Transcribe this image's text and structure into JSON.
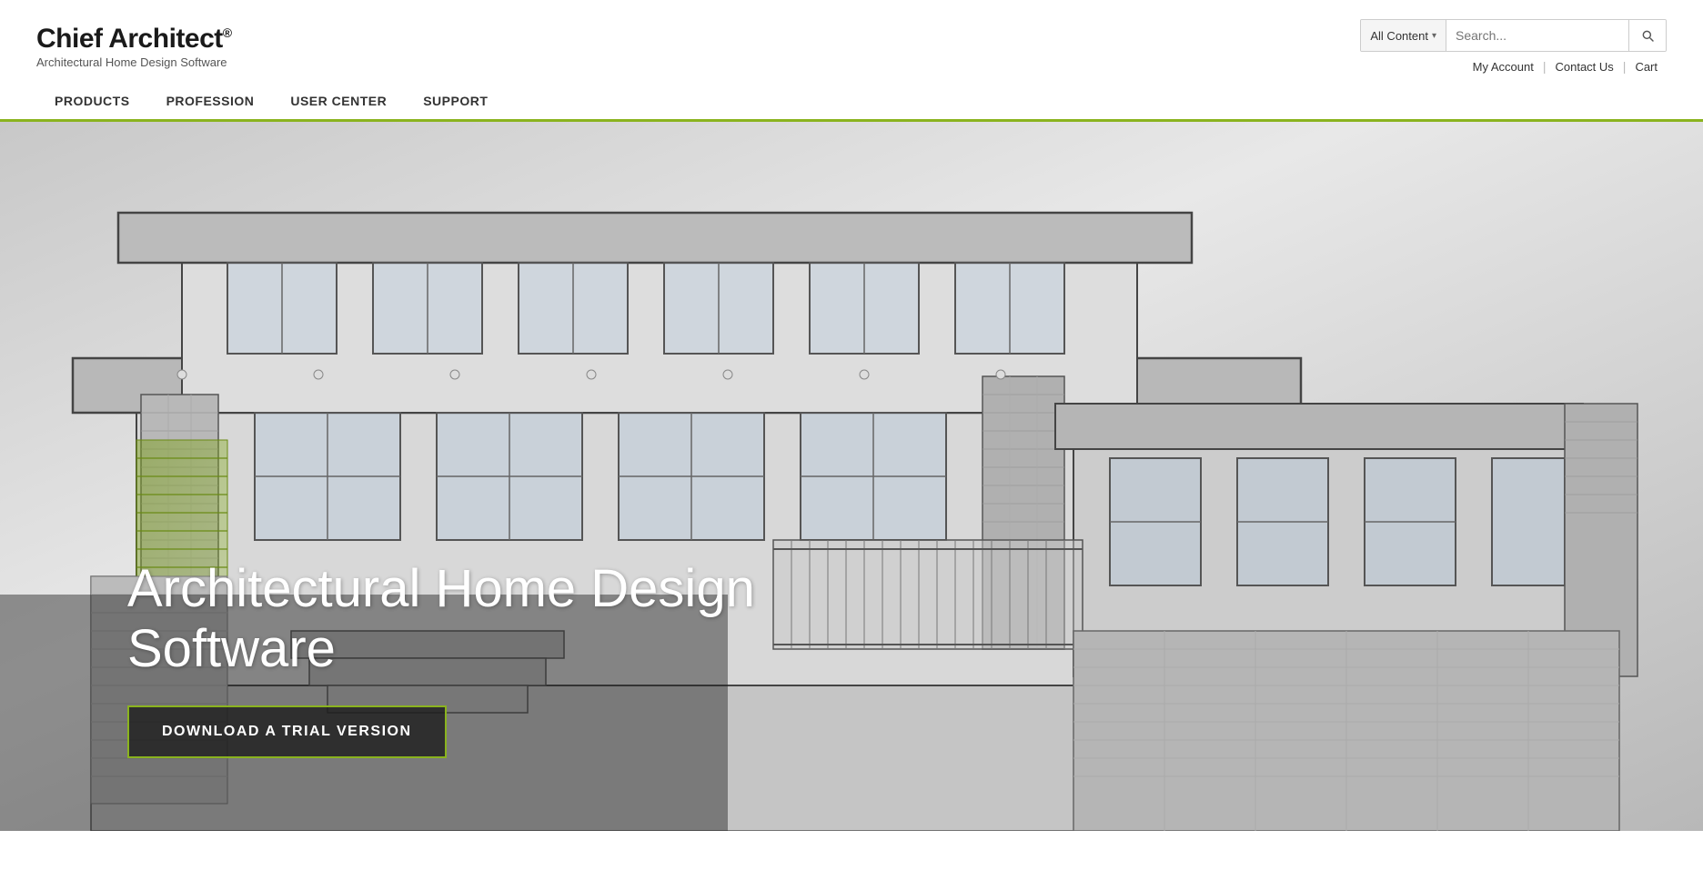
{
  "header": {
    "logo_title": "Chief Architect",
    "logo_trademark": "®",
    "logo_subtitle": "Architectural Home Design Software",
    "search": {
      "category_label": "All Content",
      "placeholder": "Search..."
    },
    "account_links": [
      {
        "id": "my-account",
        "label": "My Account"
      },
      {
        "id": "contact-us",
        "label": "Contact Us"
      },
      {
        "id": "cart",
        "label": "Cart"
      }
    ]
  },
  "nav": {
    "items": [
      {
        "id": "products",
        "label": "PRODUCTS"
      },
      {
        "id": "profession",
        "label": "PROFESSION"
      },
      {
        "id": "user-center",
        "label": "USER CENTER"
      },
      {
        "id": "support",
        "label": "SUPPORT"
      }
    ]
  },
  "hero": {
    "title": "Architectural Home Design Software",
    "cta_label": "DOWNLOAD A TRIAL VERSION"
  },
  "colors": {
    "accent": "#8ab31e",
    "nav_border": "#8ab31e",
    "hero_overlay": "rgba(30,30,30,0.82)"
  }
}
